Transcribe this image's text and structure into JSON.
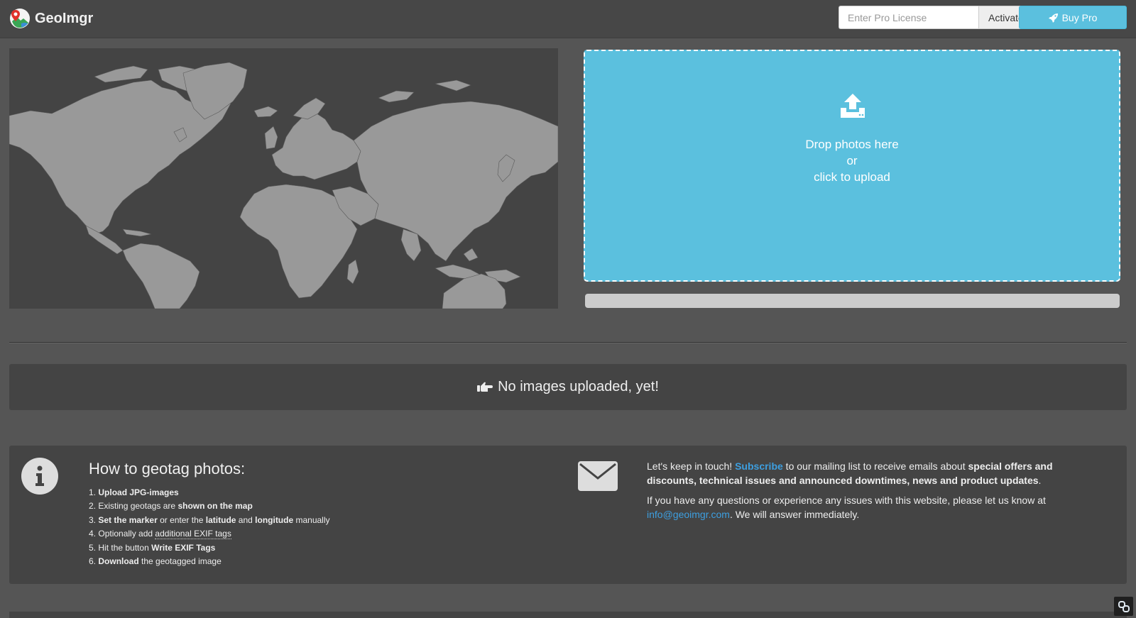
{
  "header": {
    "brand_name": "GeoImgr",
    "license_placeholder": "Enter Pro License",
    "activate_label": "Activate",
    "buy_label": "Buy Pro",
    "accent_color": "#5bc0de"
  },
  "dropzone": {
    "line1": "Drop photos here",
    "line2": "or",
    "line3": "click to upload",
    "icon": "upload-icon"
  },
  "upload_progress": 0,
  "no_images": {
    "message": "No images uploaded, yet!",
    "icon": "hand-pointing-right-icon"
  },
  "howto": {
    "title": "How to geotag photos:",
    "steps": [
      {
        "num": "1.",
        "pre": "",
        "bold": "Upload JPG-images",
        "post": ""
      },
      {
        "num": "2.",
        "pre": "Existing geotags are ",
        "bold": "shown on the map",
        "post": ""
      },
      {
        "num": "3.",
        "bold1": "Set the marker",
        "mid1": " or enter the ",
        "bold2": "latitude",
        "mid2": " and ",
        "bold3": "longitude",
        "post": " manually"
      },
      {
        "num": "4.",
        "pre": "Optionally add ",
        "abbr": "additional EXIF tags",
        "post": ""
      },
      {
        "num": "5.",
        "pre": "Hit the button ",
        "bold": "Write EXIF Tags",
        "post": ""
      },
      {
        "num": "6.",
        "pre": "",
        "bold": "Download",
        "post": " the geotagged image"
      }
    ]
  },
  "contact": {
    "p1_start": "Let's keep in touch! ",
    "subscribe_link": "Subscribe",
    "p1_mid": " to our mailing list to receive emails about ",
    "p1_bold": "special offers and discounts, technical issues and announced downtimes, news and product updates",
    "p1_end": ".",
    "p2_start": "If you have any questions or experience any issues with this website, please let us know at ",
    "email_link": "info@geoimgr.com",
    "p2_end": ". We will answer immediately."
  }
}
